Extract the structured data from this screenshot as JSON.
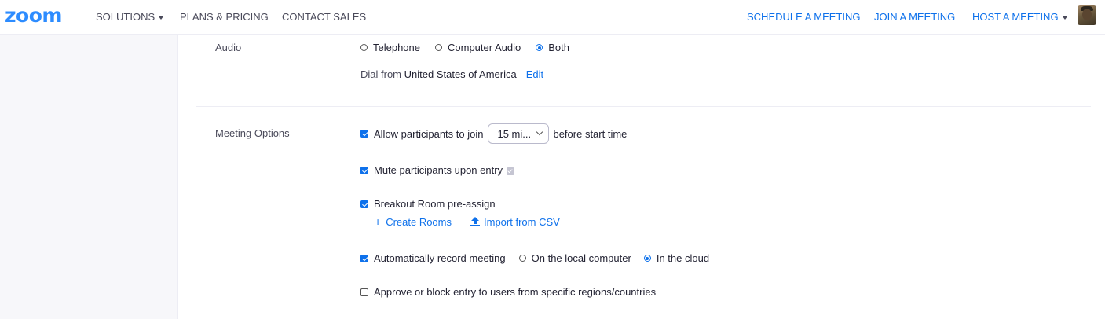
{
  "nav": {
    "logo": "zoom",
    "solutions": "SOLUTIONS",
    "plans": "PLANS & PRICING",
    "contact": "CONTACT SALES",
    "schedule": "SCHEDULE A MEETING",
    "join": "JOIN A MEETING",
    "host": "HOST A MEETING"
  },
  "audio": {
    "label": "Audio",
    "options": [
      "Telephone",
      "Computer Audio",
      "Both"
    ],
    "selected": "Both",
    "dial_prefix": "Dial from",
    "dial_country": "United States of America",
    "edit": "Edit"
  },
  "meeting_options": {
    "label": "Meeting Options",
    "join_before": {
      "prefix": "Allow participants to join",
      "select_value": "15 mi...",
      "suffix": "before start time",
      "checked": true
    },
    "mute": {
      "label": "Mute participants upon entry",
      "checked": true
    },
    "breakout": {
      "label": "Breakout Room pre-assign",
      "checked": true,
      "create_rooms": "Create Rooms",
      "import_csv": "Import from CSV"
    },
    "record": {
      "label": "Automatically record meeting",
      "checked": true,
      "options": [
        "On the local computer",
        "In the cloud"
      ],
      "selected": "In the cloud"
    },
    "approve": {
      "label": "Approve or block entry to users from specific regions/countries",
      "checked": false
    }
  },
  "colors": {
    "accent": "#0e71eb",
    "logo": "#2d8cff",
    "sidebar_bg": "#f7f7fa"
  }
}
